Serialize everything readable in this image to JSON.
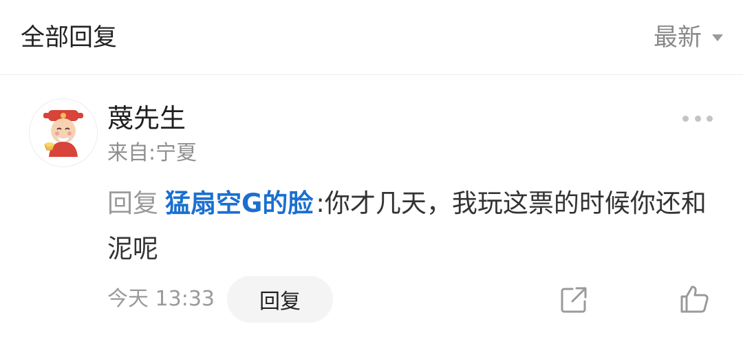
{
  "header": {
    "title": "全部回复",
    "sort_label": "最新",
    "sort_icon": "caret-down-icon"
  },
  "comment": {
    "username": "蔑先生",
    "location": "来自:宁夏",
    "reply_prefix": "回复",
    "mention": "猛扇空G的脸",
    "separator": ":",
    "text": "你才几天，我玩这票的时候你还和泥呢",
    "time": "今天 13:33",
    "reply_button": "回复",
    "icons": {
      "avatar": "avatar-cartoon-god-of-wealth",
      "more": "more-dots-icon",
      "share": "share-icon",
      "like": "thumbs-up-icon"
    }
  },
  "colors": {
    "mention": "#1a6fd0",
    "secondary_text": "#8f8f8f",
    "primary_text": "#222222"
  }
}
